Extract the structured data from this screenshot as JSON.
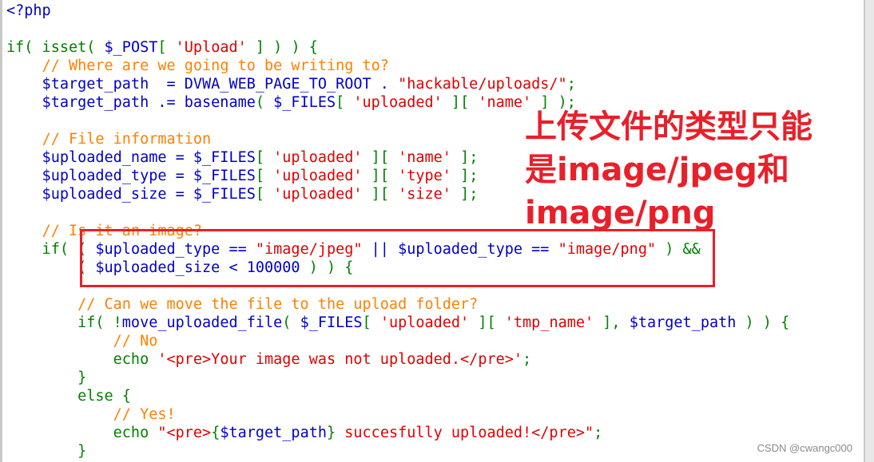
{
  "code_lines": [
    [
      [
        "v",
        "<?php"
      ]
    ],
    [],
    [
      [
        "k",
        "if( isset( "
      ],
      [
        "v",
        "$_POST"
      ],
      [
        "k",
        "[ "
      ],
      [
        "s",
        "'Upload'"
      ],
      [
        "k",
        " ] ) ) {"
      ]
    ],
    [
      [
        "k",
        "    "
      ],
      [
        "c",
        "// Where are we going to be writing to?"
      ]
    ],
    [
      [
        "v",
        "    $target_path  = DVWA_WEB_PAGE_TO_ROOT . "
      ],
      [
        "s",
        "\"hackable/uploads/\""
      ],
      [
        "k",
        ";"
      ]
    ],
    [
      [
        "v",
        "    $target_path .= basename"
      ],
      [
        "k",
        "( "
      ],
      [
        "v",
        "$_FILES"
      ],
      [
        "k",
        "[ "
      ],
      [
        "s",
        "'uploaded'"
      ],
      [
        "k",
        " ][ "
      ],
      [
        "s",
        "'name'"
      ],
      [
        "k",
        " ] );"
      ]
    ],
    [],
    [
      [
        "k",
        "    "
      ],
      [
        "c",
        "// File information"
      ]
    ],
    [
      [
        "v",
        "    $uploaded_name = $_FILES"
      ],
      [
        "k",
        "[ "
      ],
      [
        "s",
        "'uploaded'"
      ],
      [
        "k",
        " ][ "
      ],
      [
        "s",
        "'name'"
      ],
      [
        "k",
        " ];"
      ]
    ],
    [
      [
        "v",
        "    $uploaded_type = $_FILES"
      ],
      [
        "k",
        "[ "
      ],
      [
        "s",
        "'uploaded'"
      ],
      [
        "k",
        " ][ "
      ],
      [
        "s",
        "'type'"
      ],
      [
        "k",
        " ];"
      ]
    ],
    [
      [
        "v",
        "    $uploaded_size = $_FILES"
      ],
      [
        "k",
        "[ "
      ],
      [
        "s",
        "'uploaded'"
      ],
      [
        "k",
        " ][ "
      ],
      [
        "s",
        "'size'"
      ],
      [
        "k",
        " ];"
      ]
    ],
    [],
    [
      [
        "k",
        "    "
      ],
      [
        "c",
        "// Is it an image?"
      ]
    ],
    [
      [
        "k",
        "    if( ( "
      ],
      [
        "v",
        "$uploaded_type == "
      ],
      [
        "s",
        "\"image/jpeg\""
      ],
      [
        "v",
        " || $uploaded_type == "
      ],
      [
        "s",
        "\"image/png\""
      ],
      [
        "k",
        " ) &&"
      ]
    ],
    [
      [
        "k",
        "        ( "
      ],
      [
        "v",
        "$uploaded_size < 100000"
      ],
      [
        "k",
        " ) ) {"
      ]
    ],
    [],
    [
      [
        "k",
        "        "
      ],
      [
        "c",
        "// Can we move the file to the upload folder?"
      ]
    ],
    [
      [
        "k",
        "        if( !"
      ],
      [
        "v",
        "move_uploaded_file"
      ],
      [
        "k",
        "( "
      ],
      [
        "v",
        "$_FILES"
      ],
      [
        "k",
        "[ "
      ],
      [
        "s",
        "'uploaded'"
      ],
      [
        "k",
        " ][ "
      ],
      [
        "s",
        "'tmp_name'"
      ],
      [
        "k",
        " ], "
      ],
      [
        "v",
        "$target_path"
      ],
      [
        "k",
        " ) ) {"
      ]
    ],
    [
      [
        "k",
        "            "
      ],
      [
        "c",
        "// No"
      ]
    ],
    [
      [
        "k",
        "            echo "
      ],
      [
        "s",
        "'<pre>Your image was not uploaded.</pre>'"
      ],
      [
        "k",
        ";"
      ]
    ],
    [
      [
        "k",
        "        }"
      ]
    ],
    [
      [
        "k",
        "        else {"
      ]
    ],
    [
      [
        "k",
        "            "
      ],
      [
        "c",
        "// Yes!"
      ]
    ],
    [
      [
        "k",
        "            echo "
      ],
      [
        "s",
        "\"<pre>"
      ],
      [
        "k",
        "{"
      ],
      [
        "v",
        "$target_path"
      ],
      [
        "k",
        "}"
      ],
      [
        "s",
        " succesfully uploaded!</pre>\""
      ],
      [
        "k",
        ";"
      ]
    ],
    [
      [
        "k",
        "        }"
      ]
    ]
  ],
  "annotation": {
    "lines": [
      "上传文件的类型只能",
      "是image/jpeg和",
      "image/png"
    ],
    "color": "#e8202a"
  },
  "watermark": "CSDN @cwangc000",
  "colors": {
    "keyword": "#008000",
    "variable": "#0000c8",
    "string": "#e00000",
    "comment": "#ff8000"
  }
}
